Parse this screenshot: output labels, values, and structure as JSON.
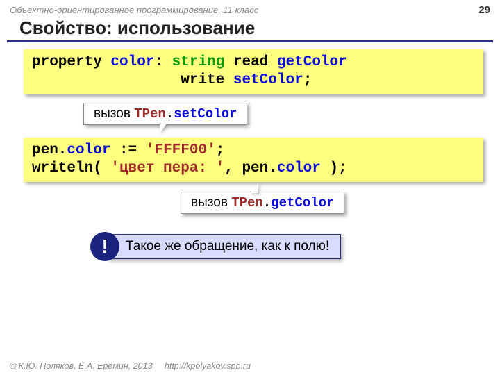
{
  "header": {
    "course": "Объектно-ориентированное программирование, 11 класс",
    "page": "29"
  },
  "title": "Свойство: использование",
  "code1": {
    "t1": "property ",
    "t2": "color",
    "t3": ": ",
    "t4": "string",
    "t5": " read ",
    "t6": "getColor",
    "t7": "                 write ",
    "t8": "setColor",
    "t9": ";"
  },
  "callout1": {
    "prefix": "вызов ",
    "cls": "TPen",
    "dot": ".",
    "method": "setColor"
  },
  "code2": {
    "l1a": "pen.",
    "l1b": "color",
    "l1c": " := ",
    "l1d": "'FFFF00'",
    "l1e": ";",
    "l2a": "writeln( ",
    "l2b": "'цвет пера: '",
    "l2c": ", pen.",
    "l2d": "color",
    "l2e": " );"
  },
  "callout2": {
    "prefix": "вызов ",
    "cls": "TPen",
    "dot": ".",
    "method": "getColor"
  },
  "note": {
    "badge": "!",
    "text": "Такое же обращение, как к полю!"
  },
  "footer": {
    "copyright": "© К.Ю. Поляков, Е.А. Ерёмин, 2013",
    "url": "http://kpolyakov.spb.ru"
  }
}
